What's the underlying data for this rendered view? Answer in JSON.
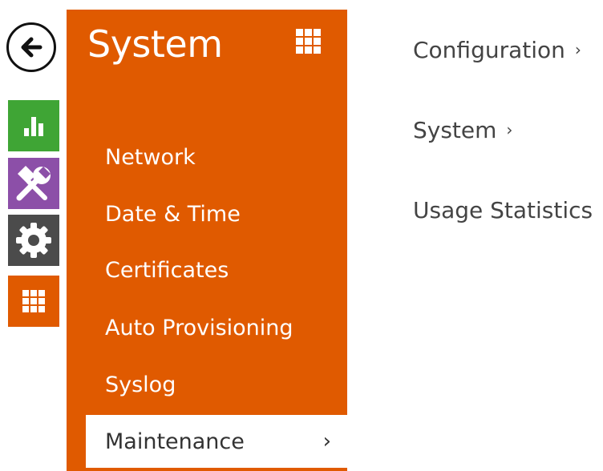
{
  "colors": {
    "panel": "#e05a00",
    "status": "#3fa535",
    "services": "#8c4fa8",
    "hardware": "#4b4b4b",
    "system": "#e05a00"
  },
  "rail": {
    "back_icon": "arrow-left-icon",
    "items": [
      {
        "id": "status",
        "icon": "bar-chart-icon"
      },
      {
        "id": "services",
        "icon": "tools-icon"
      },
      {
        "id": "hardware",
        "icon": "gear-icon"
      },
      {
        "id": "system",
        "icon": "grid-icon"
      }
    ]
  },
  "panel": {
    "title": "System",
    "menu": [
      {
        "label": "Network"
      },
      {
        "label": "Date & Time"
      },
      {
        "label": "Certificates"
      },
      {
        "label": "Auto Provisioning"
      },
      {
        "label": "Syslog"
      },
      {
        "label": "Maintenance",
        "active": true,
        "chevron": "›"
      }
    ]
  },
  "subnav": {
    "items": [
      {
        "label": "Configuration",
        "chevron": "›"
      },
      {
        "label": "System",
        "chevron": "›"
      },
      {
        "label": "Usage Statistics",
        "chevron": "›"
      }
    ]
  }
}
